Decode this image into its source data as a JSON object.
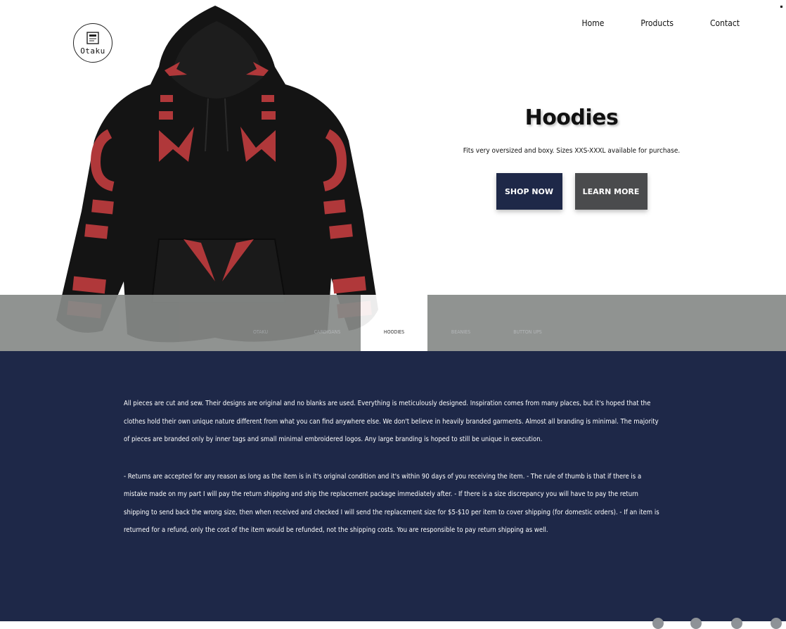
{
  "brand": {
    "logo_text": "Otaku"
  },
  "nav": {
    "items": [
      "Home",
      "Products",
      "Contact"
    ]
  },
  "hero": {
    "title": "Hoodies",
    "subtitle": "Fits very oversized and boxy. Sizes XXS-XXXL available for purchase.",
    "shop_label": "SHOP NOW",
    "learn_label": "LEARN MORE"
  },
  "tabs": [
    {
      "label": "OTAKU",
      "active": false
    },
    {
      "label": "CARDIGANS",
      "active": false
    },
    {
      "label": "HOODIES",
      "active": true
    },
    {
      "label": "BEANIES",
      "active": false
    },
    {
      "label": "BUTTON UPS",
      "active": false
    }
  ],
  "info": {
    "paragraph1": "All pieces are cut and sew. Their designs are original and no blanks are used. Everything is meticulously designed. Inspiration comes from many places, but it's hoped that the clothes hold their own unique nature different from what you can find anywhere else. We don't believe in heavily branded garments. Almost all branding is minimal. The majority of pieces are branded only by inner tags and small minimal embroidered logos. Any large branding is hoped to still be unique in execution.",
    "paragraph2": "- Returns are accepted for any reason as long as the item is in it's original condition and it's within 90 days of you receiving the item. - The rule of thumb is that if there is a mistake made on my part I will pay the return shipping and ship the replacement package immediately after. - If there is a size discrepancy you will have to pay the return shipping to send back the wrong size, then when received and checked I will send the replacement size for $5-$10 per item to cover shipping (for domestic orders). - If an item is returned for a refund, only the cost of the item would be refunded, not the shipping costs. You are responsible to pay return shipping as well."
  },
  "colors": {
    "navy": "#1e2848",
    "gray_button": "#4a4b4d",
    "tab_bar": "#878a88",
    "hoodie_red": "#b0383a"
  },
  "social_icons": [
    "instagram-icon",
    "twitter-icon",
    "pinterest-icon",
    "facebook-icon"
  ]
}
